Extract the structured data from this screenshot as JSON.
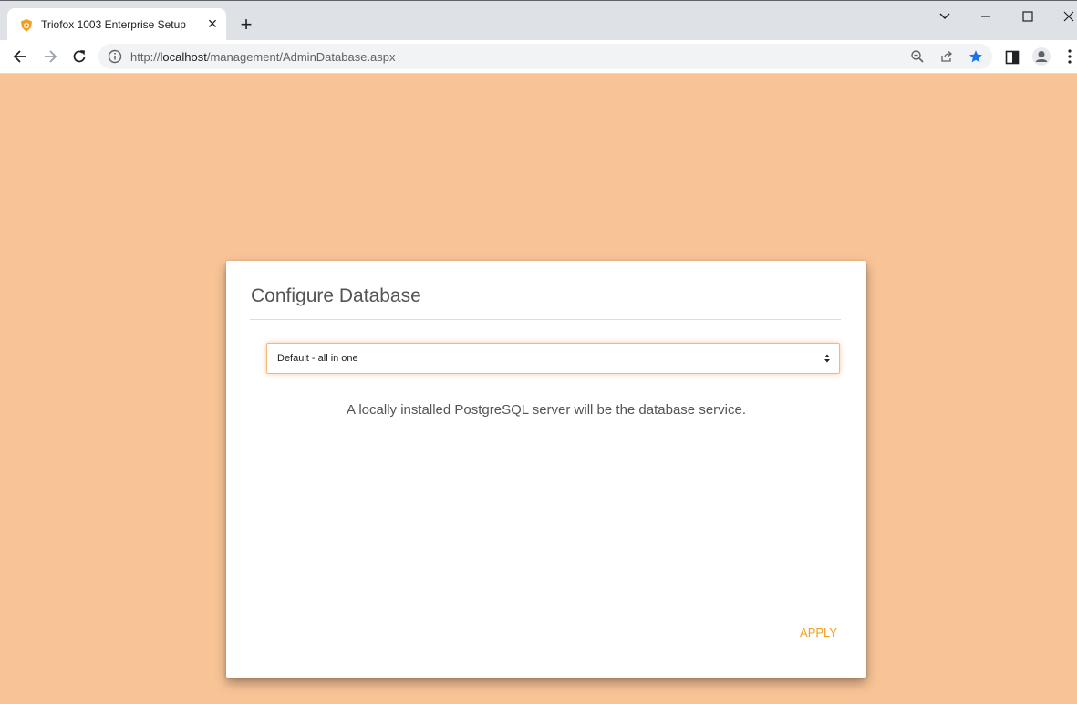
{
  "browser": {
    "tab_title": "Triofox 1003 Enterprise Setup",
    "url_scheme": "http://",
    "url_host": "localhost",
    "url_path": "/management/AdminDatabase.aspx"
  },
  "page": {
    "background_color": "#f8c496",
    "accent_color": "#f29f1e"
  },
  "dialog": {
    "title": "Configure Database",
    "database_select": {
      "selected": "Default - all in one"
    },
    "description": "A locally installed PostgreSQL server will be the database service.",
    "apply_label": "APPLY"
  }
}
